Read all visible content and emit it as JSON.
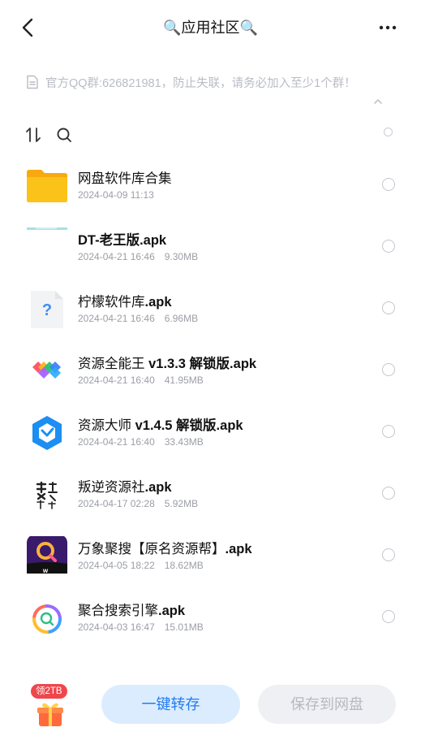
{
  "header": {
    "title": "🔍应用社区🔍",
    "back_icon": "chevron-left-icon",
    "more_icon": "more-horizontal-icon"
  },
  "notice": {
    "text": "官方QQ群:626821981，防止失联，请务必加入至少1个群！",
    "icon": "document-icon"
  },
  "toolbar": {
    "sort_icon": "sort-icon",
    "search_icon": "search-icon"
  },
  "files": [
    {
      "name": "网盘软件库合集",
      "bold": "",
      "date": "2024-04-09 11:13",
      "size": "",
      "thumb": "folder-icon"
    },
    {
      "name": "DT-老王版",
      "bold": ".apk",
      "date": "2024-04-21 16:46",
      "size": "9.30MB",
      "thumb": "apk-thumbnail"
    },
    {
      "name": "柠檬软件库",
      "bold": ".apk",
      "date": "2024-04-21 16:46",
      "size": "6.96MB",
      "thumb": "unknown-file-icon"
    },
    {
      "name": "资源全能王 ",
      "bold": "v1.3.3 解锁版.apk",
      "date": "2024-04-21 16:40",
      "size": "41.95MB",
      "thumb": "app-icon-colorful-diamonds"
    },
    {
      "name": "资源大师 ",
      "bold": "v1.4.5 解锁版.apk",
      "date": "2024-04-21 16:40",
      "size": "33.43MB",
      "thumb": "app-icon-blue-hexagon"
    },
    {
      "name": "叛逆资源社",
      "bold": ".apk",
      "date": "2024-04-17 02:28",
      "size": "5.92MB",
      "thumb": "app-icon-calligraphy"
    },
    {
      "name": "万象聚搜【原名资源帮】",
      "bold": ".apk",
      "date": "2024-04-05 18:22",
      "size": "18.62MB",
      "thumb": "app-icon-purple-search"
    },
    {
      "name": "聚合搜索引擎",
      "bold": ".apk",
      "date": "2024-04-03 16:47",
      "size": "15.01MB",
      "thumb": "app-icon-ring-search"
    }
  ],
  "bottom": {
    "gift_badge": "领2TB",
    "gift_icon": "gift-icon",
    "primary_button": "一键转存",
    "secondary_button": "保存到网盘"
  },
  "colors": {
    "accent": "#1f7cf0",
    "primary_bg": "#dcecff",
    "disabled_bg": "#eef0f3",
    "badge": "#f0464b"
  }
}
